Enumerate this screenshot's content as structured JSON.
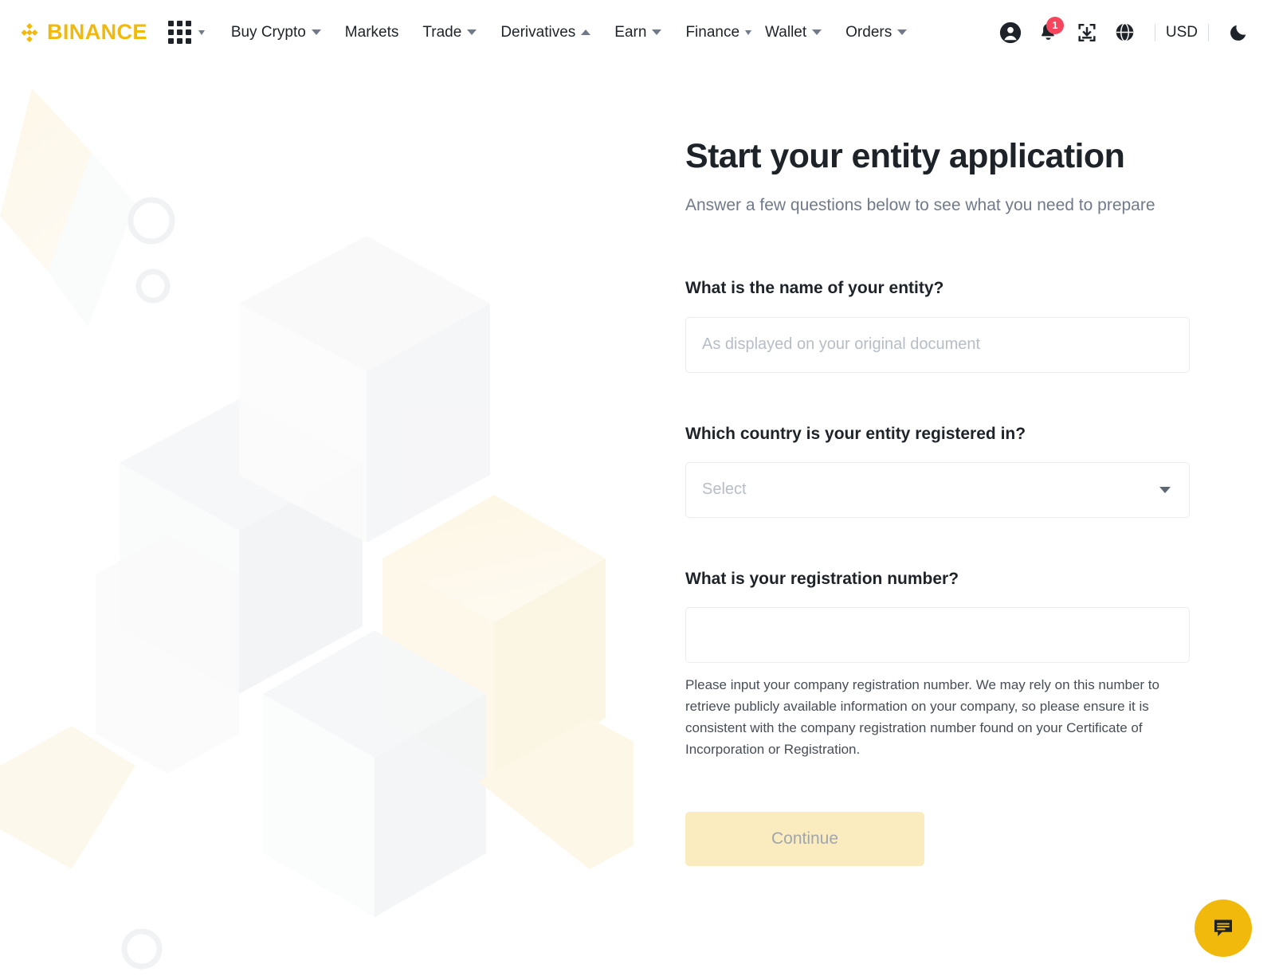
{
  "navbar": {
    "brand": "BINANCE",
    "apps_icon": "apps-grid-icon",
    "links": [
      {
        "label": "Buy Crypto",
        "caret": "down"
      },
      {
        "label": "Markets",
        "caret": "none"
      },
      {
        "label": "Trade",
        "caret": "down"
      },
      {
        "label": "Derivatives",
        "caret": "up"
      },
      {
        "label": "Earn",
        "caret": "down"
      },
      {
        "label": "Finance",
        "caret": "down"
      },
      {
        "label": "Wallet",
        "caret": "down"
      },
      {
        "label": "Orders",
        "caret": "down"
      }
    ],
    "icons": {
      "profile": "user-profile-icon",
      "notification": "bell-icon",
      "downloads": "download-app-icon",
      "language": "globe-icon",
      "theme": "moon-icon"
    },
    "notification_count": "1",
    "currency": "USD"
  },
  "main": {
    "title": "Start your entity application",
    "subtitle": "Answer a few questions below to see what you need to prepare",
    "fields": [
      {
        "label": "What is the name of your entity?",
        "type": "text",
        "value": "",
        "placeholder": "As displayed on your original document"
      },
      {
        "label": "Which country is your entity registered in?",
        "type": "select",
        "value": "Select"
      },
      {
        "label": "What is your registration number?",
        "type": "text",
        "value": "",
        "placeholder": "",
        "helper": "Please input your company registration number. We may rely on this number to retrieve publicly available information on your company, so please ensure it is consistent with the company registration number found on your Certificate of Incorporation or Registration."
      }
    ],
    "submit_label": "Continue"
  },
  "chat": {
    "icon": "chat-bubble-icon"
  },
  "colors": {
    "brand_yellow": "#f0b90b",
    "button_disabled_bg": "#faecbf",
    "badge_red": "#f6465d",
    "text_primary": "#1e2329",
    "text_secondary": "#707a8a"
  }
}
